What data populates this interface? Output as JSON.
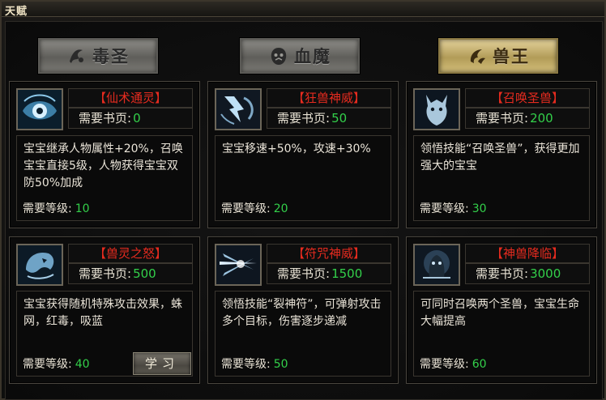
{
  "window": {
    "title": "天赋"
  },
  "tabs": [
    {
      "label": "毒圣",
      "active": false,
      "icon": "poison-emblem-icon"
    },
    {
      "label": "血魔",
      "active": false,
      "icon": "demon-face-icon"
    },
    {
      "label": "兽王",
      "active": true,
      "icon": "beast-claw-icon"
    }
  ],
  "labels": {
    "pages": "需要书页:",
    "level": "需要等级:",
    "learn": "学习"
  },
  "talents": [
    {
      "name": "【仙术通灵】",
      "pages": "0",
      "desc": "宝宝继承人物属性+20%，召唤宝宝直接5级，人物获得宝宝双防50%加成",
      "level": "10",
      "icon": "spirit-eye-icon"
    },
    {
      "name": "【狂兽神威】",
      "pages": "50",
      "desc": "宝宝移速+50%，攻速+30%",
      "level": "20",
      "icon": "lightning-beast-icon"
    },
    {
      "name": "【召唤圣兽】",
      "pages": "200",
      "desc": "领悟技能“召唤圣兽”，获得更加强大的宝宝",
      "level": "30",
      "icon": "holy-beast-icon"
    },
    {
      "name": "【兽灵之怒】",
      "pages": "500",
      "desc": "宝宝获得随机特殊攻击效果，蛛网，红毒，吸蓝",
      "level": "40",
      "icon": "beast-spirit-icon",
      "has_learn": true
    },
    {
      "name": "【符咒神威】",
      "pages": "1500",
      "desc": "领悟技能“裂神符”，可弹射攻击多个目标，伤害逐步递减",
      "level": "50",
      "icon": "talisman-burst-icon"
    },
    {
      "name": "【神兽降临】",
      "pages": "3000",
      "desc": "可同时召唤两个圣兽，宝宝生命大幅提高",
      "level": "60",
      "icon": "divine-beast-icon"
    }
  ]
}
